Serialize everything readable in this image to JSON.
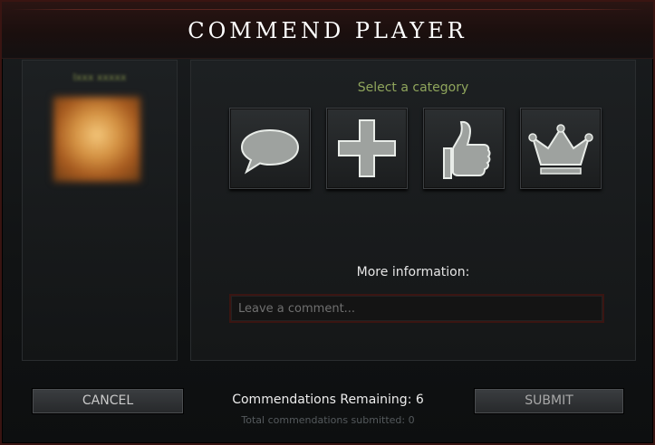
{
  "title": "COMMEND PLAYER",
  "player": {
    "name": "Ixxx xxxxx"
  },
  "categories": {
    "prompt": "Select a category",
    "items": [
      {
        "icon": "speech-bubble-icon"
      },
      {
        "icon": "plus-icon"
      },
      {
        "icon": "thumbs-up-icon"
      },
      {
        "icon": "crown-icon"
      }
    ]
  },
  "more_info": {
    "label": "More information:",
    "placeholder": "Leave a comment...",
    "value": ""
  },
  "buttons": {
    "cancel": "CANCEL",
    "submit": "SUBMIT"
  },
  "status": {
    "remaining": "Commendations Remaining: 6",
    "total": "Total commendations submitted: 0"
  },
  "colors": {
    "accent_green": "#8fa55c",
    "frame_red": "#3a1512",
    "icon_gray": "#9ea29f"
  }
}
